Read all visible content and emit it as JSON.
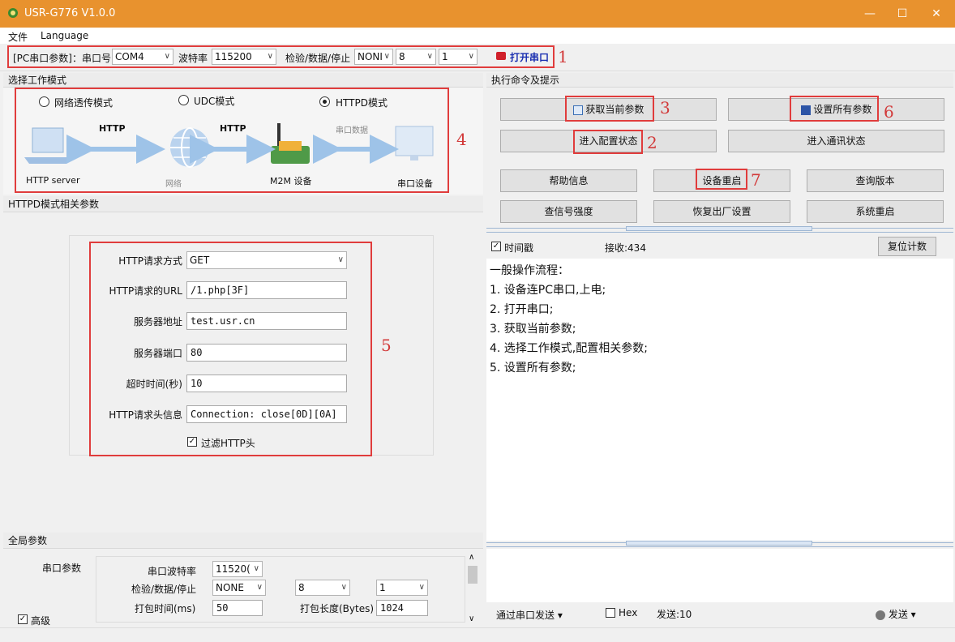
{
  "window": {
    "title": "USR-G776 V1.0.0"
  },
  "menu": [
    "文件",
    "Language"
  ],
  "serial": {
    "group_label": "[PC串口参数]：串口号",
    "port": "COM4",
    "baud_label": "波特率",
    "baud": "115200",
    "parity_label": "检验/数据/停止",
    "parity": "NONI",
    "data_bits": "8",
    "stop_bits": "1",
    "open_button": "打开串口"
  },
  "workmode": {
    "title": "选择工作模式",
    "modes": [
      "网络透传模式",
      "UDC模式",
      "HTTPD模式"
    ],
    "selected": "HTTPD模式",
    "diagram": {
      "http_server": "HTTP server",
      "http1": "HTTP",
      "network": "网络",
      "http2": "HTTP",
      "m2m": "M2M 设备",
      "serial_data": "串口数据",
      "serial_device": "串口设备"
    }
  },
  "httpd": {
    "title": "HTTPD模式相关参数",
    "method_label": "HTTP请求方式",
    "method": "GET",
    "url_label": "HTTP请求的URL",
    "url": "/1.php[3F]",
    "server_label": "服务器地址",
    "server": "test.usr.cn",
    "port_label": "服务器端口",
    "port": "80",
    "timeout_label": "超时时间(秒)",
    "timeout": "10",
    "header_label": "HTTP请求头信息",
    "header": "Connection: close[0D][0A]",
    "filter_label": "过滤HTTP头",
    "filter_checked": true
  },
  "global": {
    "title": "全局参数",
    "serial_params": "串口参数",
    "baud_label": "串口波特率",
    "baud": "11520(",
    "parity_label": "检验/数据/停止",
    "parity": "NONE",
    "data_bits": "8",
    "stop_bits": "1",
    "pack_time_label": "打包时间(ms)",
    "pack_time": "50",
    "pack_len_label": "打包长度(Bytes)",
    "pack_len": "1024",
    "advanced": "高级"
  },
  "commands": {
    "title": "执行命令及提示",
    "get_params": "获取当前参数",
    "set_params": "设置所有参数",
    "enter_config": "进入配置状态",
    "enter_comm": "进入通讯状态",
    "help": "帮助信息",
    "restart_device": "设备重启",
    "query_version": "查询版本",
    "query_signal": "查信号强度",
    "factory_reset": "恢复出厂设置",
    "system_restart": "系统重启"
  },
  "log": {
    "timestamp_label": "时间戳",
    "recv": "接收:434",
    "reset_button": "复位计数",
    "lines": [
      "一般操作流程：",
      "1. 设备连PC串口,上电;",
      "2. 打开串口;",
      "3. 获取当前参数;",
      "4. 选择工作模式,配置相关参数;",
      "5. 设置所有参数;"
    ]
  },
  "send": {
    "mode": "通过串口发送",
    "hex": "Hex",
    "sent": "发送:10",
    "send_button": "发送"
  },
  "annotations": [
    "1",
    "2",
    "3",
    "4",
    "5",
    "6",
    "7"
  ],
  "colors": {
    "title_bar": "#e8922e",
    "annotation": "#e03c3c",
    "open_led": "#d0202a",
    "open_text": "#1a2fb0"
  }
}
